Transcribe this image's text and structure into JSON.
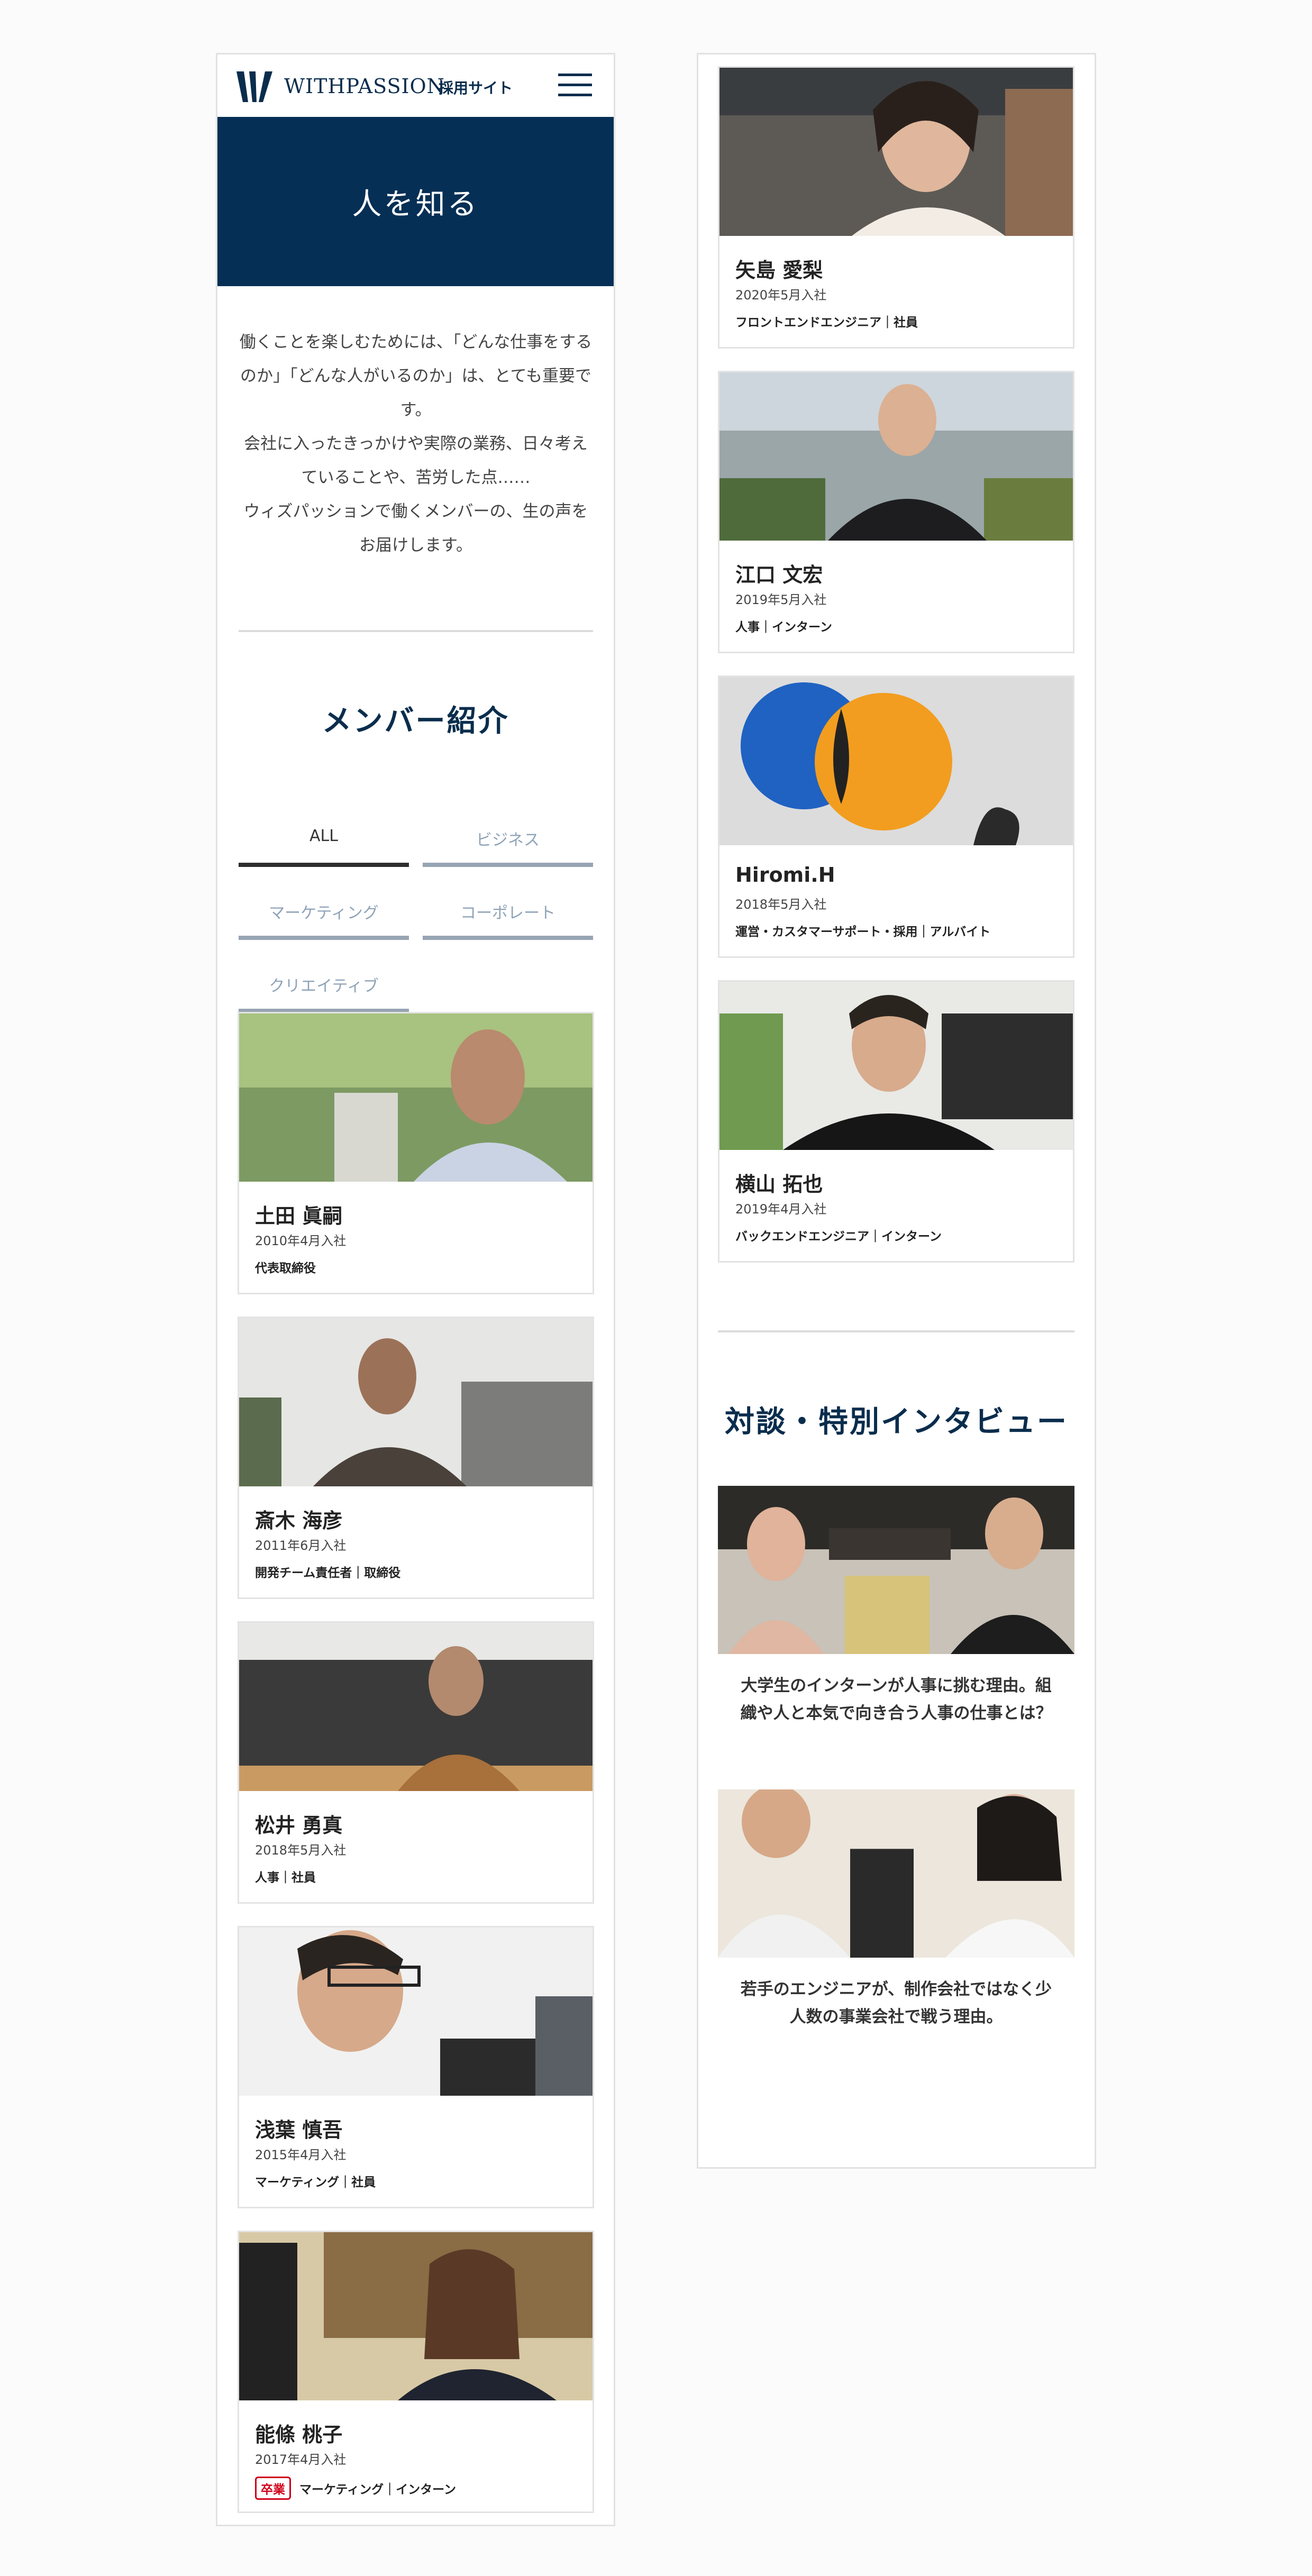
{
  "header": {
    "logo_text": "WITHPASSION",
    "logo_sub": "採用サイト",
    "menu_icon": "hamburger-menu-icon"
  },
  "hero": {
    "title": "人を知る"
  },
  "intro": {
    "lines": [
      "働くことを楽しむためには、「どんな仕事をするのか」「どんな人がいるのか」は、とても重要です。",
      "会社に入ったきっかけや実際の業務、日々考えていることや、苦労した点……",
      "ウィズパッションで働くメンバーの、生の声をお届けします。"
    ]
  },
  "members": {
    "title": "メンバー紹介",
    "tabs": [
      {
        "label": "ALL",
        "active": true
      },
      {
        "label": "ビジネス",
        "active": false
      },
      {
        "label": "マーケティング",
        "active": false
      },
      {
        "label": "コーポレート",
        "active": false
      },
      {
        "label": "クリエイティブ",
        "active": false
      }
    ],
    "cards": [
      {
        "name": "土田 眞嗣",
        "joined": "2010年4月入社",
        "roles": "代表取締役",
        "badge": ""
      },
      {
        "name": "斎木 海彦",
        "joined": "2011年6月入社",
        "roles": "開発チーム責任者｜取締役",
        "badge": ""
      },
      {
        "name": "松井 勇真",
        "joined": "2018年5月入社",
        "roles": "人事｜社員",
        "badge": ""
      },
      {
        "name": "浅葉 慎吾",
        "joined": "2015年4月入社",
        "roles": "マーケティング｜社員",
        "badge": ""
      },
      {
        "name": "能條 桃子",
        "joined": "2017年4月入社",
        "roles": "マーケティング｜インターン",
        "badge": "卒業"
      },
      {
        "name": "矢島 愛梨",
        "joined": "2020年5月入社",
        "roles": "フロントエンドエンジニア｜社員",
        "badge": ""
      },
      {
        "name": "江口 文宏",
        "joined": "2019年5月入社",
        "roles": "人事｜インターン",
        "badge": ""
      },
      {
        "name": "Hiromi.H",
        "joined": "2018年5月入社",
        "roles": "運営・カスタマーサポート・採用｜アルバイト",
        "badge": ""
      },
      {
        "name": "横山 拓也",
        "joined": "2019年4月入社",
        "roles": "バックエンドエンジニア｜インターン",
        "badge": ""
      }
    ]
  },
  "interviews": {
    "title": "対談・特別インタビュー",
    "items": [
      {
        "caption": "大学生のインターンが人事に挑む理由。組織や人と本気で向き合う人事の仕事とは？"
      },
      {
        "caption": "若手のエンジニアが、制作会社ではなく少人数の事業会社で戦う理由。"
      }
    ]
  },
  "colors": {
    "brand_navy": "#062f55",
    "tab_active": "#2e2e2e",
    "tab_inactive": "#97a4b3",
    "badge_red": "#d0021b"
  }
}
